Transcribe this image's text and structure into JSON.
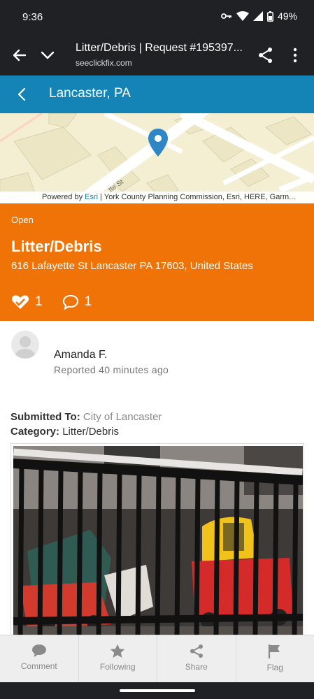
{
  "status_bar": {
    "time": "9:36",
    "battery": "49%"
  },
  "browser": {
    "title": "Litter/Debris | Request #195397...",
    "url": "seeclickfix.com",
    "icons": [
      "arrow-back-icon",
      "chevron-down-icon",
      "share-icon",
      "more-vert-icon"
    ]
  },
  "header": {
    "title": "Lancaster, PA"
  },
  "map": {
    "street_label": "tte St",
    "attribution_prefix": "Powered by ",
    "attribution_esri": "Esri",
    "attribution_rest": " | York County Planning Commission, Esri, HERE, Garm..."
  },
  "issue": {
    "status": "Open",
    "title": "Litter/Debris",
    "address": "616 Lafayette St Lancaster PA 17603, United States",
    "support_count": "1",
    "comment_count": "1"
  },
  "reporter": {
    "name": "Amanda F.",
    "reported": "Reported 40 minutes ago"
  },
  "details": {
    "submitted_label": "Submitted To:",
    "submitted_value": "City of Lancaster",
    "category_label": "Category:",
    "category_value": "Litter/Debris"
  },
  "bottom_nav": {
    "comment": "Comment",
    "following": "Following",
    "share": "Share",
    "flag": "Flag"
  },
  "colors": {
    "browser_bar": "#202124",
    "header": "#1483b5",
    "issue_card": "#f07308",
    "bottom_nav": "#eeeeee"
  }
}
